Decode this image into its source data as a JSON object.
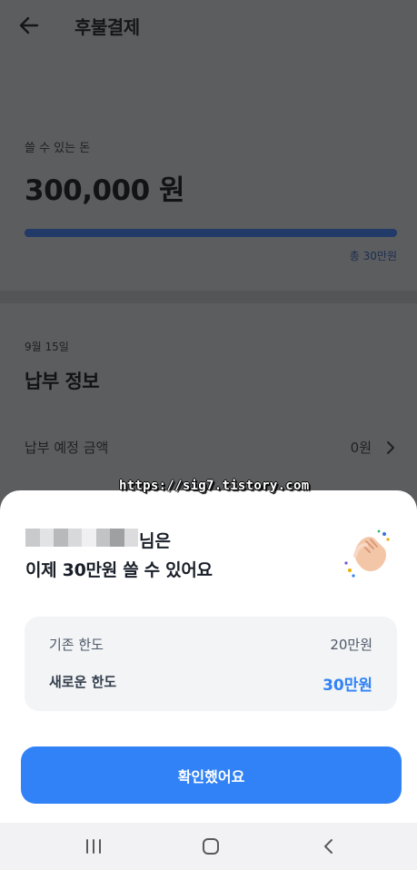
{
  "header": {
    "title": "후불결제",
    "back_icon": "arrow-left-icon"
  },
  "balance": {
    "label": "쓸 수 있는 돈",
    "amount": "300,000 원",
    "progress_fraction": 1.0,
    "total_text": "총 30만원"
  },
  "payment_info": {
    "date": "9월 15일",
    "title": "납부 정보",
    "due_label": "납부 예정 금액",
    "due_value": "0원",
    "chevron_icon": "chevron-right-icon"
  },
  "watermark": "https://sig7.tistory.com",
  "sheet": {
    "name_suffix": "님은",
    "headline": "이제 30만원 쓸 수 있어요",
    "emoji_icon": "clapping-hands-icon",
    "limits": [
      {
        "label": "기존 한도",
        "value": "20만원"
      },
      {
        "label": "새로운 한도",
        "value": "30만원"
      }
    ],
    "confirm_label": "확인했어요"
  },
  "navbar": {
    "recents_icon": "recents-icon",
    "home_icon": "home-icon",
    "back_icon": "back-icon"
  },
  "colors": {
    "accent": "#3182f6",
    "overlay": "#5c5d5f",
    "sheet": "#ffffff",
    "card": "#f2f4f6"
  }
}
